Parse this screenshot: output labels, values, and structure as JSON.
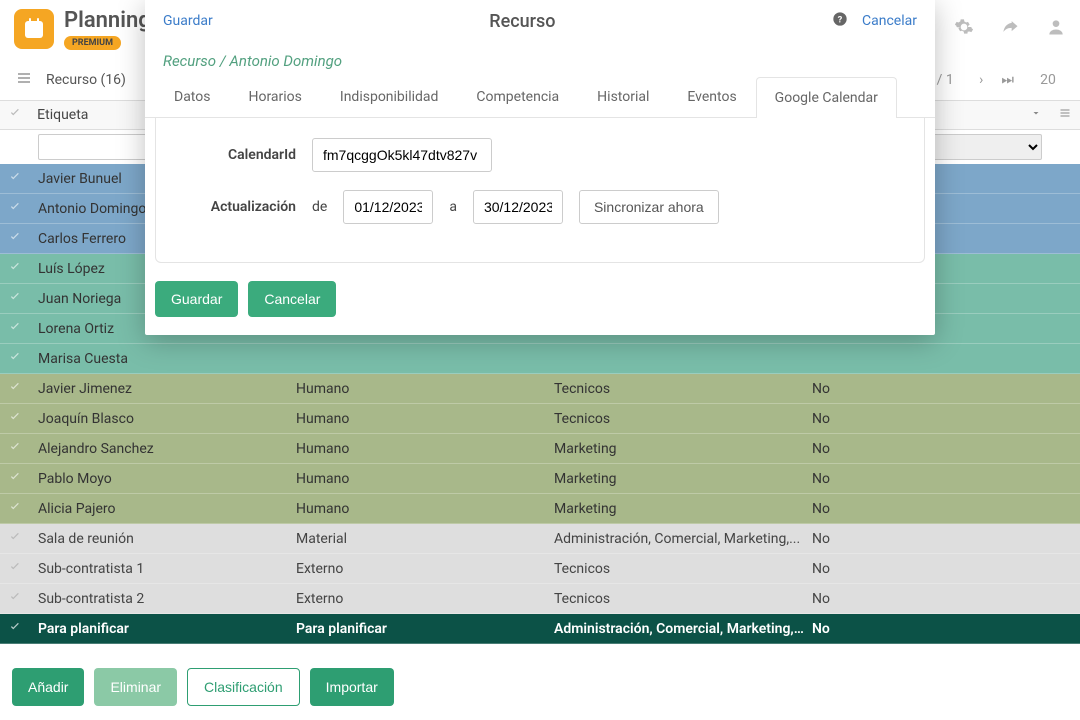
{
  "brand": {
    "name": "Planning",
    "tier": "PREMIUM"
  },
  "subheader": {
    "title": "Recurso (16)",
    "page": "/ 1",
    "page_size": "20"
  },
  "grid": {
    "headers": {
      "col1": "Etiqueta"
    },
    "rows": [
      {
        "zone": "blue",
        "label": "Javier Bunuel",
        "type": "",
        "serv": "",
        "bool": ""
      },
      {
        "zone": "blue",
        "label": "Antonio Domingo",
        "type": "",
        "serv": "",
        "bool": ""
      },
      {
        "zone": "blue",
        "label": "Carlos Ferrero",
        "type": "",
        "serv": "",
        "bool": ""
      },
      {
        "zone": "teal",
        "label": "Luís López",
        "type": "",
        "serv": "",
        "bool": ""
      },
      {
        "zone": "teal",
        "label": "Juan Noriega",
        "type": "",
        "serv": "",
        "bool": ""
      },
      {
        "zone": "teal",
        "label": "Lorena Ortiz",
        "type": "",
        "serv": "",
        "bool": ""
      },
      {
        "zone": "teal",
        "label": "Marisa Cuesta",
        "type": "",
        "serv": "",
        "bool": ""
      },
      {
        "zone": "olive",
        "label": "Javier Jimenez",
        "type": "Humano",
        "serv": "Tecnicos",
        "bool": "No"
      },
      {
        "zone": "olive",
        "label": "Joaquín Blasco",
        "type": "Humano",
        "serv": "Tecnicos",
        "bool": "No"
      },
      {
        "zone": "olive",
        "label": "Alejandro Sanchez",
        "type": "Humano",
        "serv": "Marketing",
        "bool": "No"
      },
      {
        "zone": "olive",
        "label": "Pablo Moyo",
        "type": "Humano",
        "serv": "Marketing",
        "bool": "No"
      },
      {
        "zone": "olive",
        "label": "Alicia Pajero",
        "type": "Humano",
        "serv": "Marketing",
        "bool": "No"
      },
      {
        "zone": "gray",
        "label": "Sala de reunión",
        "type": "Material",
        "serv": "Administración, Comercial, Marketing,...",
        "bool": "No"
      },
      {
        "zone": "gray",
        "label": "Sub-contratista 1",
        "type": "Externo",
        "serv": "Tecnicos",
        "bool": "No"
      },
      {
        "zone": "gray",
        "label": "Sub-contratista 2",
        "type": "Externo",
        "serv": "Tecnicos",
        "bool": "No"
      },
      {
        "zone": "dark",
        "label": "Para planificar",
        "type": "Para planificar",
        "serv": "Administración, Comercial, Marketing,...",
        "bool": "No"
      }
    ]
  },
  "footer": {
    "add": "Añadir",
    "delete": "Eliminar",
    "classify": "Clasificación",
    "import": "Importar"
  },
  "modal": {
    "save_link": "Guardar",
    "title": "Recurso",
    "cancel_link": "Cancelar",
    "crumb": "Recurso / Antonio Domingo",
    "tabs": [
      "Datos",
      "Horarios",
      "Indisponibilidad",
      "Competencia",
      "Historial",
      "Eventos",
      "Google Calendar"
    ],
    "active_tab": 6,
    "form": {
      "calendar_label": "CalendarId",
      "calendar_value": "fm7qcggOk5kl47dtv827v",
      "update_label": "Actualización",
      "de": "de",
      "from": "01/12/2023",
      "a": "a",
      "to": "30/12/2023",
      "sync": "Sincronizar ahora"
    },
    "actions": {
      "save": "Guardar",
      "cancel": "Cancelar"
    }
  }
}
